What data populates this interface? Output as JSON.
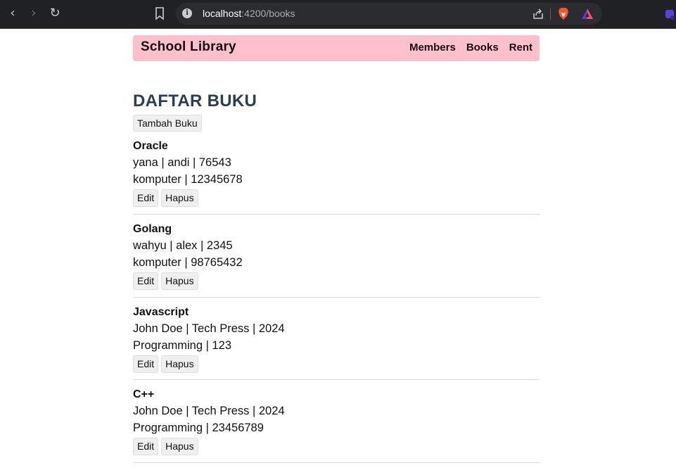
{
  "browser": {
    "url_host": "localhost",
    "url_path": ":4200/books"
  },
  "app": {
    "brand": "School Library",
    "nav": [
      {
        "label": "Members"
      },
      {
        "label": "Books"
      },
      {
        "label": "Rent"
      }
    ]
  },
  "page": {
    "title": "DAFTAR BUKU",
    "add_button": "Tambah Buku"
  },
  "books": [
    {
      "title": "Oracle",
      "line1": "yana | andi | 76543",
      "line2": "komputer | 12345678",
      "edit": "Edit",
      "delete": "Hapus"
    },
    {
      "title": "Golang",
      "line1": "wahyu | alex | 2345",
      "line2": "komputer | 98765432",
      "edit": "Edit",
      "delete": "Hapus"
    },
    {
      "title": "Javascript",
      "line1": "John Doe | Tech Press | 2024",
      "line2": "Programming | 123",
      "edit": "Edit",
      "delete": "Hapus"
    },
    {
      "title": "C++",
      "line1": "John Doe | Tech Press | 2024",
      "line2": "Programming | 23456789",
      "edit": "Edit",
      "delete": "Hapus"
    }
  ]
}
